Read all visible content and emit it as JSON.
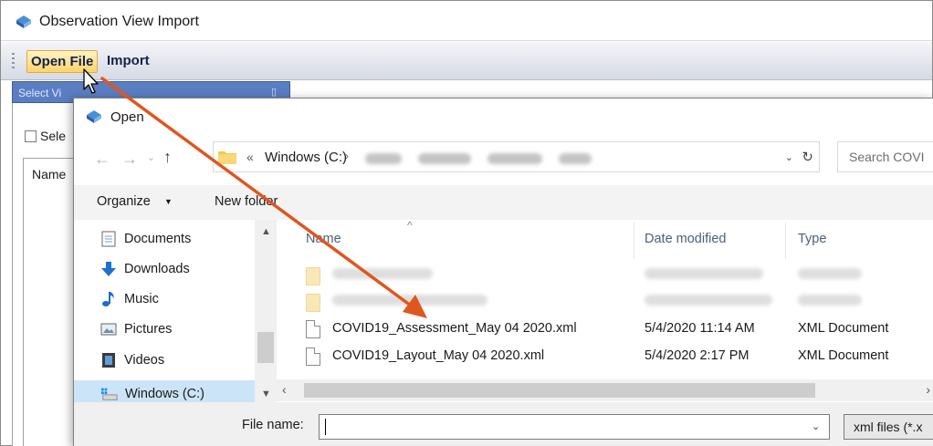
{
  "app": {
    "title": "Observation View Import",
    "toolbar": {
      "open_file_label": "Open File",
      "import_label": "Import"
    },
    "panel": {
      "header_label": "Select Vi",
      "select_all_label": "Sele",
      "name_column_label": "Name"
    }
  },
  "dialog": {
    "title": "Open",
    "address": {
      "chevrons": "«",
      "drive_label": "Windows (C:)",
      "separator": "›"
    },
    "search_placeholder": "Search COVI",
    "command_bar": {
      "organize_label": "Organize",
      "new_folder_label": "New folder"
    },
    "nav_pane": {
      "items": [
        {
          "label": "Documents",
          "icon": "documents-icon"
        },
        {
          "label": "Downloads",
          "icon": "download-arrow-icon"
        },
        {
          "label": "Music",
          "icon": "music-note-icon"
        },
        {
          "label": "Pictures",
          "icon": "pictures-icon"
        },
        {
          "label": "Videos",
          "icon": "film-icon"
        },
        {
          "label": "Windows (C:)",
          "icon": "drive-icon",
          "selected": true
        }
      ]
    },
    "columns": {
      "name": "Name",
      "date_modified": "Date modified",
      "type": "Type"
    },
    "files": [
      {
        "name": "COVID19_Assessment_May 04 2020.xml",
        "date": "5/4/2020 11:14 AM",
        "type": "XML Document"
      },
      {
        "name": "COVID19_Layout_May 04 2020.xml",
        "date": "5/4/2020 2:17 PM",
        "type": "XML Document"
      }
    ],
    "bottom": {
      "filename_label": "File name:",
      "filename_value": "",
      "filetype_label": "xml files (*.x"
    }
  },
  "colors": {
    "accent_arrow": "#e0561f",
    "selected_nav": "#cce4f7",
    "toolbar_highlight": "#ffd36b",
    "panel_header": "#5b7ec2"
  }
}
